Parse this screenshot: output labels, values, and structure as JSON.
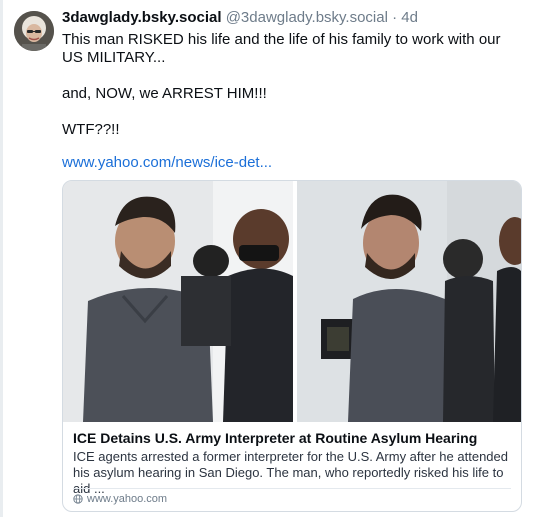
{
  "post": {
    "display_name": "3dawglady.bsky.social",
    "handle": "@3dawglady.bsky.social",
    "separator": "·",
    "time": "4d",
    "text_lines": [
      "This man RISKED his life and the life of his family to work with our US MILITARY...",
      "and, NOW, we ARREST HIM!!!",
      "WTF??!!"
    ],
    "link_text": "www.yahoo.com/news/ice-det..."
  },
  "embed": {
    "title": "ICE Detains U.S. Army Interpreter at Routine Asylum Hearing",
    "description": "ICE agents arrested a former interpreter for the U.S. Army after he attended his asylum hearing in San Diego. The man, who reportedly risked his life to aid ...",
    "domain": "www.yahoo.com"
  },
  "colors": {
    "link": "#1b6fd8",
    "muted": "#6e7c8a",
    "border": "#d4dbe2"
  },
  "icons": [
    "avatar",
    "globe-icon"
  ]
}
